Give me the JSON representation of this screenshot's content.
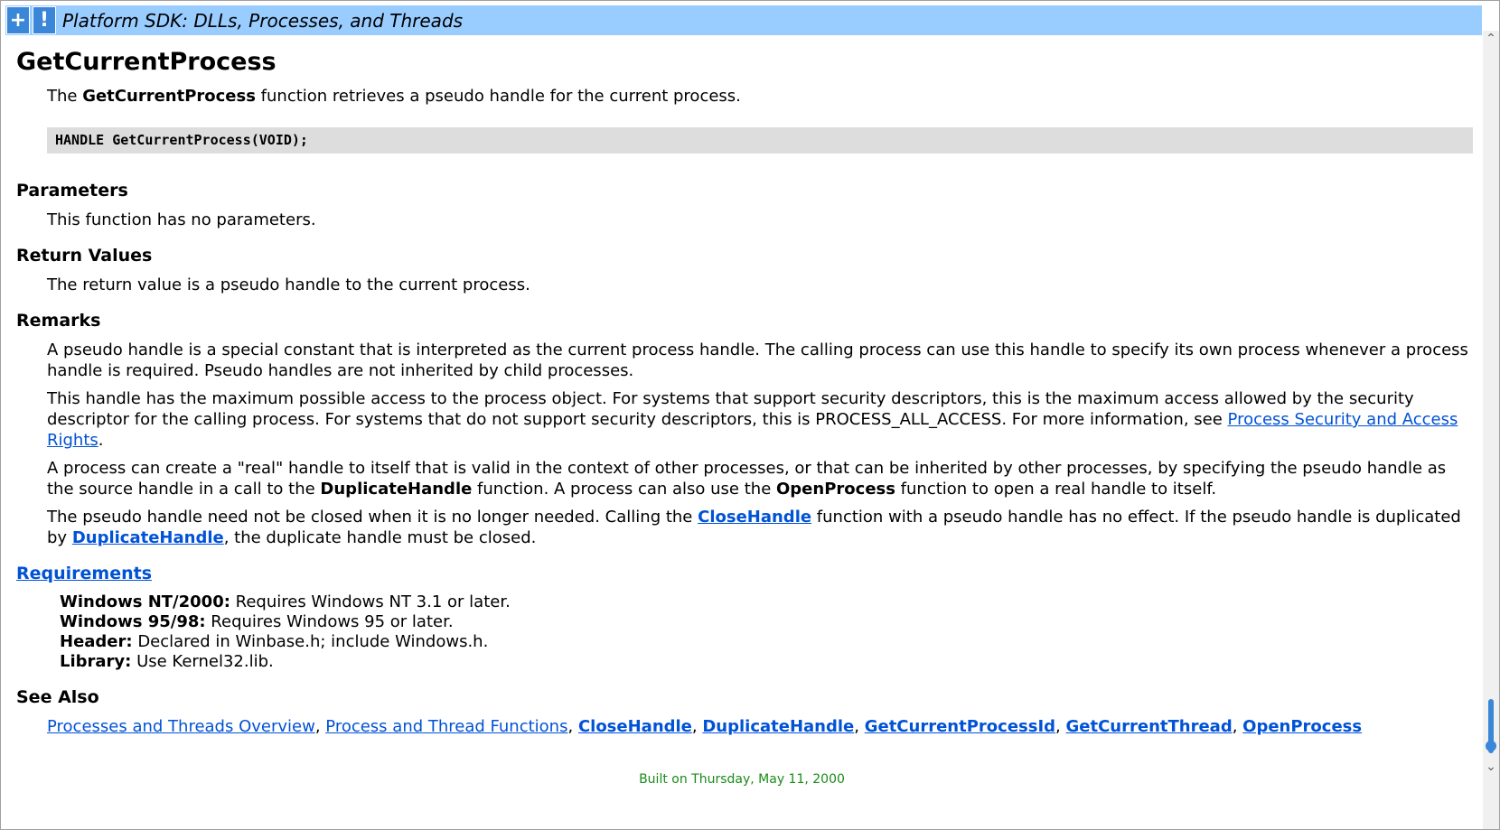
{
  "header": {
    "expand_icon": "+",
    "alert_icon": "!",
    "title": "Platform SDK: DLLs, Processes, and Threads"
  },
  "page_title": "GetCurrentProcess",
  "intro": {
    "pre": "The ",
    "bold": "GetCurrentProcess",
    "post": " function retrieves a pseudo handle for the current process."
  },
  "syntax": "HANDLE GetCurrentProcess(VOID);",
  "parameters": {
    "heading": "Parameters",
    "text": "This function has no parameters."
  },
  "return_values": {
    "heading": "Return Values",
    "text": "The return value is a pseudo handle to the current process."
  },
  "remarks": {
    "heading": "Remarks",
    "p1": "A pseudo handle is a special constant that is interpreted as the current process handle. The calling process can use this handle to specify its own process whenever a process handle is required. Pseudo handles are not inherited by child processes.",
    "p2_pre": "This handle has the maximum possible access to the process object. For systems that support security descriptors, this is the maximum access allowed by the security descriptor for the calling process. For systems that do not support security descriptors, this is PROCESS_ALL_ACCESS. For more information, see ",
    "p2_link": "Process Security and Access Rights",
    "p2_post": ".",
    "p3_pre": "A process can create a \"real\" handle to itself that is valid in the context of other processes, or that can be inherited by other processes, by specifying the pseudo handle as the source handle in a call to the ",
    "p3_bold1": "DuplicateHandle",
    "p3_mid": " function. A process can also use the ",
    "p3_bold2": "OpenProcess",
    "p3_post": " function to open a real handle to itself.",
    "p4_pre": "The pseudo handle need not be closed when it is no longer needed. Calling the ",
    "p4_link1": "CloseHandle",
    "p4_mid": " function with a pseudo handle has no effect. If the pseudo handle is duplicated by ",
    "p4_link2": "DuplicateHandle",
    "p4_post": ", the duplicate handle must be closed."
  },
  "requirements": {
    "heading": "Requirements",
    "items": [
      {
        "label": "Windows NT/2000:",
        "value": " Requires Windows NT 3.1 or later."
      },
      {
        "label": "Windows 95/98:",
        "value": " Requires Windows 95 or later."
      },
      {
        "label": "Header:",
        "value": " Declared in Winbase.h; include Windows.h."
      },
      {
        "label": "Library:",
        "value": " Use Kernel32.lib."
      }
    ]
  },
  "see_also": {
    "heading": "See Also",
    "links": [
      "Processes and Threads Overview",
      "Process and Thread Functions",
      "CloseHandle",
      "DuplicateHandle",
      "GetCurrentProcessId",
      "GetCurrentThread",
      "OpenProcess"
    ],
    "separator": ", "
  },
  "footer": "Built on Thursday, May 11, 2000",
  "colors": {
    "header_bg": "#99ccff",
    "button_bg": "#3a86d8",
    "link": "#0052d6",
    "code_bg": "#dddddd",
    "footer_text": "#1a8a1a"
  }
}
